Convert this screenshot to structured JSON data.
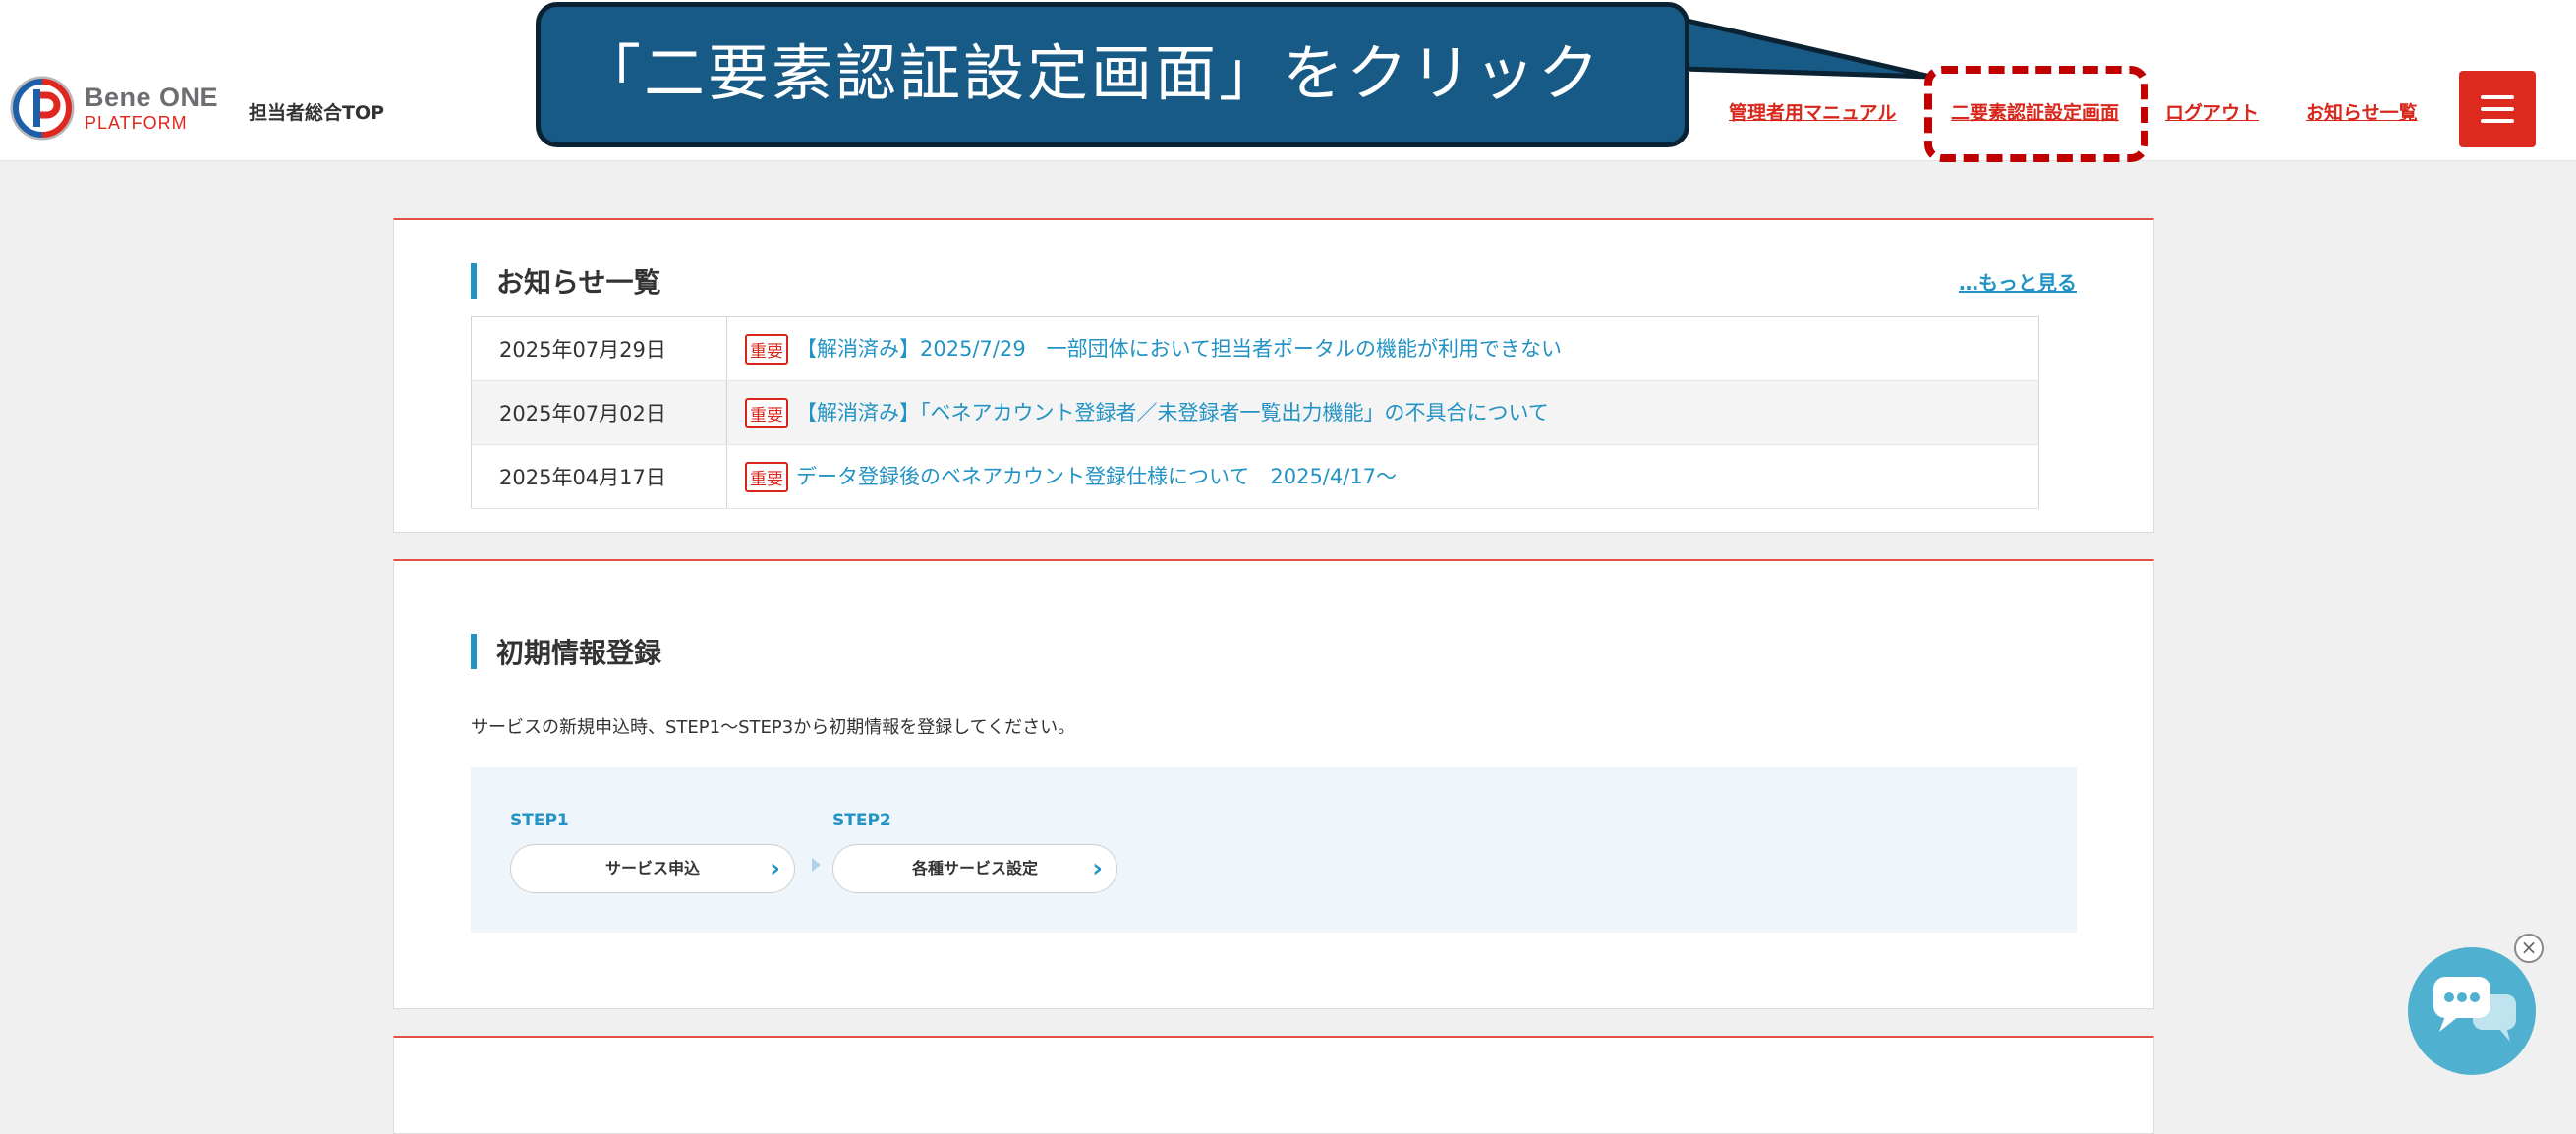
{
  "callout": {
    "text": "「二要素認証設定画面」をクリック"
  },
  "header": {
    "brand_name": "Bene ONE",
    "brand_sub": "PLATFORM",
    "top_link": "担当者総合TOP",
    "nav": {
      "manual": "管理者用マニュアル",
      "two_factor": "二要素認証設定画面",
      "logout": "ログアウト",
      "notices": "お知らせ一覧"
    },
    "menu_icon": "hamburger-icon"
  },
  "news": {
    "title": "お知らせ一覧",
    "more": "…もっと見る",
    "items": [
      {
        "date": "2025年07月29日",
        "badge": "重要",
        "text": "【解消済み】2025/7/29　一部団体において担当者ポータルの機能が利用できない"
      },
      {
        "date": "2025年07月02日",
        "badge": "重要",
        "text": "【解消済み】「ベネアカウント登録者／未登録者一覧出力機能」の不具合について"
      },
      {
        "date": "2025年04月17日",
        "badge": "重要",
        "text": "データ登録後のベネアカウント登録仕様について　2025/4/17〜"
      }
    ]
  },
  "initial": {
    "title": "初期情報登録",
    "description": "サービスの新規申込時、STEP1〜STEP3から初期情報を登録してください。",
    "steps": [
      {
        "label": "STEP1",
        "button": "サービス申込"
      },
      {
        "label": "STEP2",
        "button": "各種サービス設定"
      }
    ]
  },
  "colors": {
    "accent_red": "#d8261b",
    "accent_blue": "#2293c4",
    "callout_bg": "#175a85"
  },
  "chat": {
    "icon": "chat-bubble-icon",
    "close_icon": "close-icon"
  }
}
